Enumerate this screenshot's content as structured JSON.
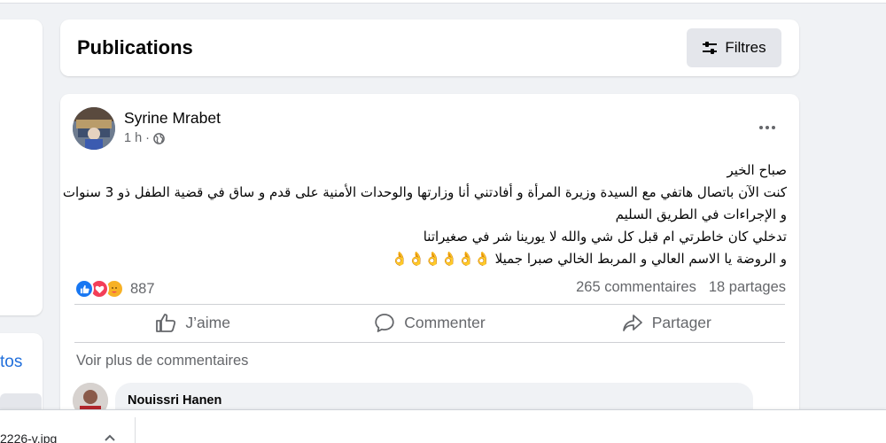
{
  "left_column": {
    "link_fragment": "tos"
  },
  "publications": {
    "title": "Publications",
    "filter_label": "Filtres"
  },
  "post": {
    "author": "Syrine Mrabet",
    "time": "1 h ·",
    "audience_icon": "globe-icon",
    "body_lines": [
      "صباح الخير",
      "كنت الآن باتصال هاتفي مع السيدة وزيرة المرأة و أفادتني أنا وزارتها والوحدات الأمنية على قدم و ساق في قضية الطفل ذو 3 سنوات",
      "و الإجراءات في الطريق السليم",
      "تدخلي كان خاطرتي ام قبل كل شي والله لا يورينا شر في صغيراتنا",
      "و الروضة يا الاسم العالي و المربط الخالي صبرا جميلا 👌👌👌👌👌👌"
    ],
    "reaction_icons": [
      "like-icon",
      "love-icon",
      "care-icon"
    ],
    "reaction_count": "887",
    "comments_count": "265 commentaires",
    "shares_count": "18 partages",
    "actions": {
      "like": "J’aime",
      "comment": "Commenter",
      "share": "Partager"
    },
    "more_comments": "Voir plus de commentaires",
    "comment": {
      "author": "Nouissri Hanen"
    }
  },
  "download_bar": {
    "filename": "2226-v.jpg"
  },
  "colors": {
    "background": "#f0f2f5",
    "card": "#ffffff",
    "secondary_text": "#65676b",
    "link_blue": "#216fdb",
    "like_blue": "#1877f2",
    "love_red": "#f33e58"
  }
}
